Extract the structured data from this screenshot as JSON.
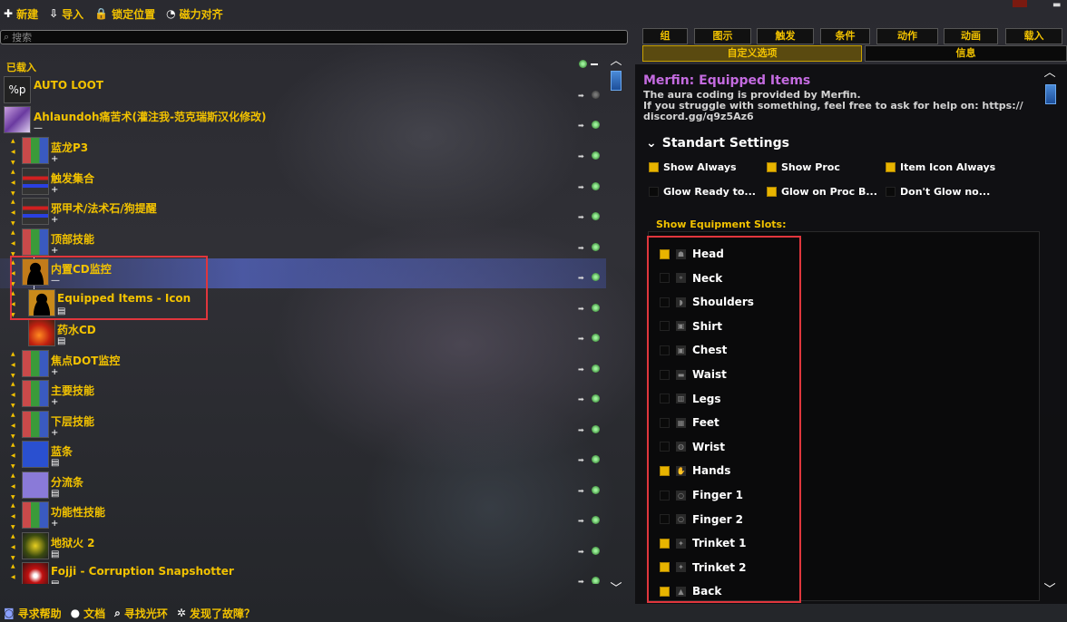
{
  "toolbar": {
    "new": "新建",
    "import": "导入",
    "lock": "锁定位置",
    "magnet": "磁力对齐"
  },
  "search": {
    "placeholder": "搜索"
  },
  "list_header": "已载入",
  "rows": [
    {
      "name": "AUTO LOOT",
      "thumb": "%p",
      "sub": ""
    },
    {
      "name": "Ahlaundoh痛苦术(灌注我-范克瑞斯汉化修改)",
      "sub": "—"
    },
    {
      "name": "蓝龙P3",
      "sub": "+"
    },
    {
      "name": "触发集合",
      "sub": "+"
    },
    {
      "name": "邪甲术/法术石/狗提醒",
      "sub": "+"
    },
    {
      "name": "顶部技能",
      "sub": "+"
    },
    {
      "name": "内置CD监控",
      "sub": "—"
    },
    {
      "name": "Equipped Items - Icon",
      "sub": "▤"
    },
    {
      "name": "药水CD",
      "sub": "▤"
    },
    {
      "name": "焦点DOT监控",
      "sub": "+"
    },
    {
      "name": "主要技能",
      "sub": "+"
    },
    {
      "name": "下层技能",
      "sub": "+"
    },
    {
      "name": "蓝条",
      "sub": "▤"
    },
    {
      "name": "分流条",
      "sub": "▤"
    },
    {
      "name": "功能性技能",
      "sub": "+"
    },
    {
      "name": "地狱火 2",
      "sub": "▤"
    },
    {
      "name": "Fojji - Corruption Snapshotter",
      "sub": "▤"
    }
  ],
  "bottombar": {
    "help": "寻求帮助",
    "docs": "文档",
    "glow": "寻找光环",
    "bug": "发现了故障？"
  },
  "tabs_row1": [
    "组",
    "图示",
    "触发",
    "条件",
    "动作",
    "动画",
    "载入"
  ],
  "tabs_row2": [
    "自定义选项",
    "信息"
  ],
  "panel": {
    "title": "Merfin: Equipped Items",
    "desc1": "The aura coding is provided by Merfin.",
    "desc2": "If you struggle with something, feel free to ask for help on: https://",
    "desc3": "discord.gg/q9z5Az6",
    "section": "Standart Settings",
    "options": [
      {
        "label": "Show Always",
        "checked": true
      },
      {
        "label": "Show Proc",
        "checked": true
      },
      {
        "label": "Item Icon Always",
        "checked": true
      },
      {
        "label": "Glow Ready to...",
        "checked": false
      },
      {
        "label": "Glow on Proc B...",
        "checked": true
      },
      {
        "label": "Don't Glow no...",
        "checked": false
      }
    ],
    "eq_label": "Show Equipment Slots:",
    "slots": [
      {
        "label": "Head",
        "checked": true
      },
      {
        "label": "Neck",
        "checked": false
      },
      {
        "label": "Shoulders",
        "checked": false
      },
      {
        "label": "Shirt",
        "checked": false
      },
      {
        "label": "Chest",
        "checked": false
      },
      {
        "label": "Waist",
        "checked": false
      },
      {
        "label": "Legs",
        "checked": false
      },
      {
        "label": "Feet",
        "checked": false
      },
      {
        "label": "Wrist",
        "checked": false
      },
      {
        "label": "Hands",
        "checked": true
      },
      {
        "label": "Finger 1",
        "checked": false
      },
      {
        "label": "Finger 2",
        "checked": false
      },
      {
        "label": "Trinket 1",
        "checked": true
      },
      {
        "label": "Trinket 2",
        "checked": true
      },
      {
        "label": "Back",
        "checked": true
      }
    ]
  },
  "colors": {
    "accent": "#f2c200",
    "title": "#c46be0",
    "highlight": "#e0363d",
    "scroll": "#3f7fd0"
  }
}
